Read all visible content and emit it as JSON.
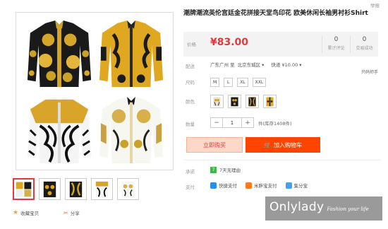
{
  "top": {
    "report": "举报"
  },
  "product": {
    "title": "潮牌潮流英伦宫廷金花拼接天堂鸟印花 欧美休闲长袖男衬衫Shirt"
  },
  "price": {
    "label": "价格",
    "value": "¥83.00",
    "stats": [
      {
        "num": "0",
        "label": "累计评论"
      },
      {
        "num": "0",
        "label": "交易成功"
      }
    ]
  },
  "delivery": {
    "label": "配送",
    "from": "广东广州 至",
    "to": "北京东城区 ▾",
    "method": "快递 ¥10.00 ▾",
    "side_note": "只码师手"
  },
  "size": {
    "label": "尺码",
    "options": [
      "M",
      "L",
      "XL",
      "XXL"
    ]
  },
  "color": {
    "label": "颜色"
  },
  "quantity": {
    "label": "数量",
    "minus": "−",
    "value": "1",
    "plus": "+",
    "stock": "件(库存1408件)"
  },
  "actions": {
    "buy_now": "立即购买",
    "add_cart": "加入购物车",
    "cart_icon": "🛒"
  },
  "promise": {
    "label": "承诺",
    "badge": "7",
    "text": "7天无理由"
  },
  "payment": {
    "label": "支付",
    "methods": [
      {
        "name": "快捷支付",
        "color": "#2a8fe0"
      },
      {
        "name": "米胖宝支付",
        "color": "#ff7a1a"
      },
      {
        "name": "集分宝",
        "color": "#44a3e8"
      }
    ]
  },
  "gallery": {
    "fav_icon": "★",
    "fav_label": "收藏宝贝",
    "share_icon": "✂",
    "share_label": "分享"
  },
  "watermark": {
    "main": "Onlylady",
    "sub": "Fashion your life"
  }
}
